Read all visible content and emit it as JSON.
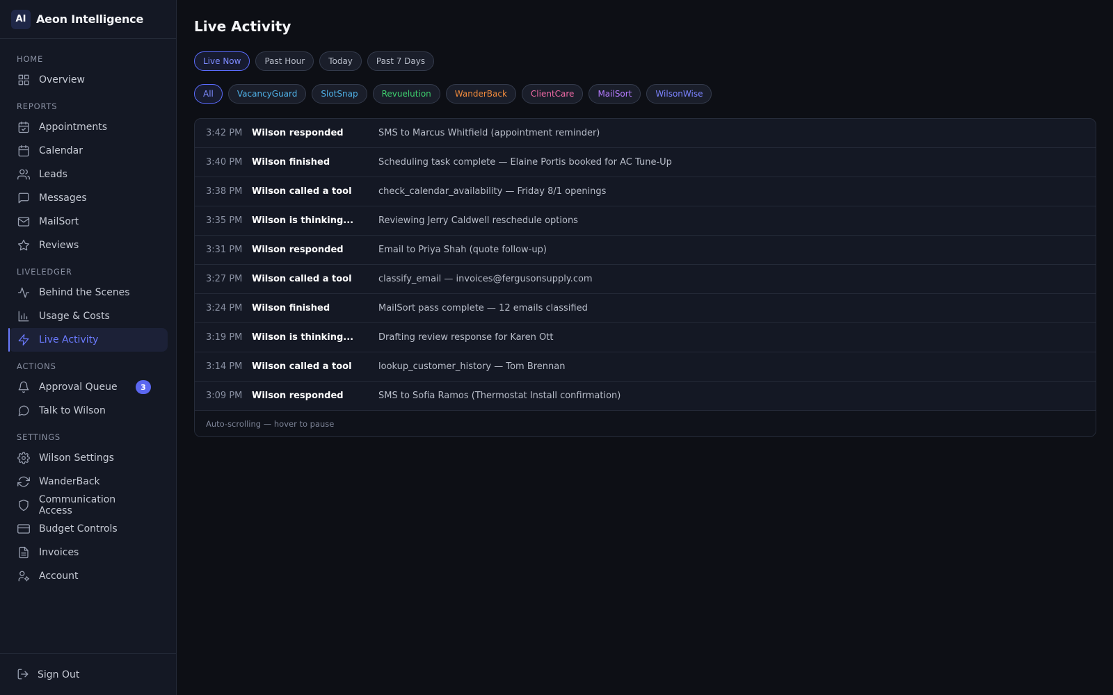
{
  "brand": {
    "logo": "AI",
    "name": "Aeon Intelligence"
  },
  "sidebar": {
    "sections": [
      {
        "label": "HOME",
        "items": [
          {
            "label": "Overview",
            "icon": "grid-icon"
          }
        ]
      },
      {
        "label": "REPORTS",
        "items": [
          {
            "label": "Appointments",
            "icon": "calendar-check-icon"
          },
          {
            "label": "Calendar",
            "icon": "calendar-icon"
          },
          {
            "label": "Leads",
            "icon": "users-icon"
          },
          {
            "label": "Messages",
            "icon": "message-square-icon"
          },
          {
            "label": "MailSort",
            "icon": "mail-icon"
          },
          {
            "label": "Reviews",
            "icon": "star-icon"
          }
        ]
      },
      {
        "label": "LIVELEDGER",
        "items": [
          {
            "label": "Behind the Scenes",
            "icon": "activity-icon"
          },
          {
            "label": "Usage & Costs",
            "icon": "bar-chart-icon"
          },
          {
            "label": "Live Activity",
            "icon": "zap-icon",
            "active": true
          }
        ]
      },
      {
        "label": "ACTIONS",
        "items": [
          {
            "label": "Approval Queue",
            "icon": "bell-icon",
            "badge": "3"
          },
          {
            "label": "Talk to Wilson",
            "icon": "message-circle-icon"
          }
        ]
      },
      {
        "label": "SETTINGS",
        "items": [
          {
            "label": "Wilson Settings",
            "icon": "gear-icon"
          },
          {
            "label": "WanderBack",
            "icon": "refresh-icon"
          },
          {
            "label": "Communication Access",
            "icon": "shield-icon"
          },
          {
            "label": "Budget Controls",
            "icon": "credit-card-icon"
          },
          {
            "label": "Invoices",
            "icon": "file-text-icon"
          },
          {
            "label": "Account",
            "icon": "user-cog-icon"
          }
        ]
      }
    ],
    "signout": "Sign Out"
  },
  "main": {
    "title": "Live Activity",
    "time_filters": [
      "Live Now",
      "Past Hour",
      "Today",
      "Past 7 Days"
    ],
    "active_time_filter": "Live Now",
    "source_filters": [
      {
        "label": "All",
        "color": "#7d8bff",
        "active": true
      },
      {
        "label": "VacancyGuard",
        "color": "#4fb0e6"
      },
      {
        "label": "SlotSnap",
        "color": "#4fb0e6"
      },
      {
        "label": "Revuelution",
        "color": "#3ecf6e"
      },
      {
        "label": "WanderBack",
        "color": "#f08a3c"
      },
      {
        "label": "ClientCare",
        "color": "#f06aa5"
      },
      {
        "label": "MailSort",
        "color": "#b57bff"
      },
      {
        "label": "WilsonWise",
        "color": "#7b83ff"
      }
    ],
    "events": [
      {
        "time": "3:42 PM",
        "actor": "Wilson responded",
        "detail": "SMS to Marcus Whitfield (appointment reminder)"
      },
      {
        "time": "3:40 PM",
        "actor": "Wilson finished",
        "detail": "Scheduling task complete — Elaine Portis booked for AC Tune-Up"
      },
      {
        "time": "3:38 PM",
        "actor": "Wilson called a tool",
        "detail": "check_calendar_availability — Friday 8/1 openings"
      },
      {
        "time": "3:35 PM",
        "actor": "Wilson is thinking...",
        "detail": "Reviewing Jerry Caldwell reschedule options"
      },
      {
        "time": "3:31 PM",
        "actor": "Wilson responded",
        "detail": "Email to Priya Shah (quote follow-up)"
      },
      {
        "time": "3:27 PM",
        "actor": "Wilson called a tool",
        "detail": "classify_email — invoices@fergusonsupply.com"
      },
      {
        "time": "3:24 PM",
        "actor": "Wilson finished",
        "detail": "MailSort pass complete — 12 emails classified"
      },
      {
        "time": "3:19 PM",
        "actor": "Wilson is thinking...",
        "detail": "Drafting review response for Karen Ott"
      },
      {
        "time": "3:14 PM",
        "actor": "Wilson called a tool",
        "detail": "lookup_customer_history — Tom Brennan"
      },
      {
        "time": "3:09 PM",
        "actor": "Wilson responded",
        "detail": "SMS to Sofia Ramos (Thermostat Install confirmation)"
      }
    ],
    "footer_note": "Auto-scrolling — hover to pause"
  }
}
